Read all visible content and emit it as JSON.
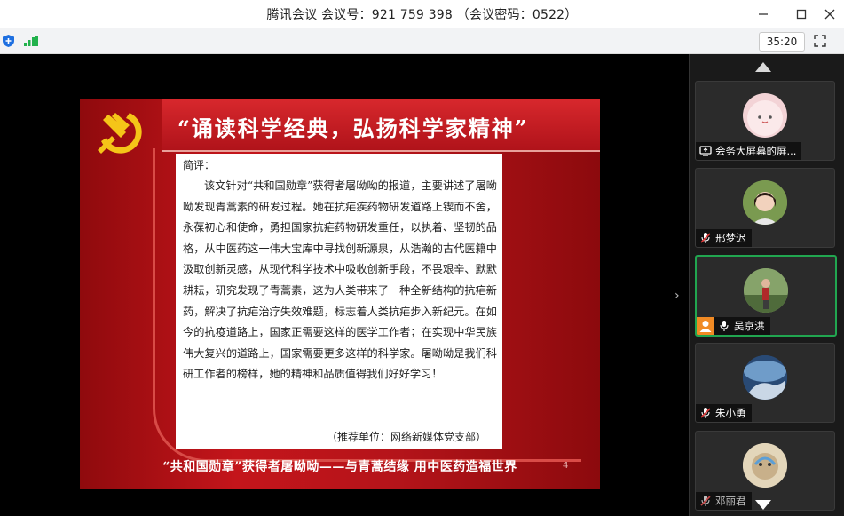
{
  "window": {
    "title": "腾讯会议 会议号：921 759 398 （会议密码：0522）",
    "controls": [
      "minimize",
      "maximize",
      "close"
    ]
  },
  "toolbar": {
    "timer": "35:20",
    "icons": [
      "shield-icon",
      "signal-icon",
      "fullscreen-icon"
    ]
  },
  "slide": {
    "heading": "“诵读科学经典，弘扬科学家精神”",
    "label": "简评：",
    "body": "该文针对“共和国勋章”获得者屠呦呦的报道，主要讲述了屠呦呦发现青蒿素的研发过程。她在抗疟疾药物研发道路上锲而不舍，永葆初心和使命，勇担国家抗疟药物研发重任，以执着、坚韧的品格，从中医药这一伟大宝库中寻找创新源泉，从浩瀚的古代医籍中汲取创新灵感，从现代科学技术中吸收创新手段，不畏艰辛、默默耕耘，研究发现了青蒿素，这为人类带来了一种全新结构的抗疟新药，解决了抗疟治疗失效难题，标志着人类抗疟步入新纪元。在如今的抗疫道路上，国家正需要这样的医学工作者；在实现中华民族伟大复兴的道路上，国家需要更多这样的科学家。屠呦呦是我们科研工作者的榜样，她的精神和品质值得我们好好学习！",
    "credit": "（推荐单位：网络新媒体党支部）",
    "footer": "“共和国勋章”获得者屠呦呦——与青蒿结缘 用中医药造福世界",
    "page_number": "4"
  },
  "participants": [
    {
      "name": "会务大屏幕的屏...",
      "status": "screen-share-icon",
      "active": false
    },
    {
      "name": "邢梦迟",
      "status": "mic-muted-icon",
      "active": false
    },
    {
      "name": "吴京洪",
      "status": "mic-icon",
      "active": true
    },
    {
      "name": "朱小勇",
      "status": "mic-muted-icon",
      "active": false
    },
    {
      "name": "邓丽君",
      "status": "mic-muted-icon",
      "active": false
    }
  ],
  "colors": {
    "accent_green": "#21a650",
    "slide_red": "#c4151b",
    "emblem_gold": "#f5c518"
  }
}
